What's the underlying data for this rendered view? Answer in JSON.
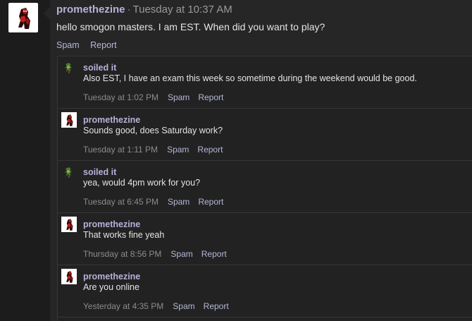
{
  "main_message": {
    "author": "promethezine",
    "separator": "·",
    "timestamp": "Tuesday at 10:37 AM",
    "body": "hello smogon masters. I am EST. When did you want to play?",
    "actions": {
      "spam": "Spam",
      "report": "Report"
    }
  },
  "comments": [
    {
      "author": "soiled it",
      "avatar": "plant-sprite-icon",
      "text": "Also EST, I have an exam this week so sometime during the weekend would be good.",
      "timestamp": "Tuesday at 1:02 PM",
      "spam": "Spam",
      "report": "Report"
    },
    {
      "author": "promethezine",
      "avatar": "deadpool-avatar",
      "text": "Sounds good, does Saturday work?",
      "timestamp": "Tuesday at 1:11 PM",
      "spam": "Spam",
      "report": "Report"
    },
    {
      "author": "soiled it",
      "avatar": "plant-sprite-icon",
      "text": "yea, would 4pm work for you?",
      "timestamp": "Tuesday at 6:45 PM",
      "spam": "Spam",
      "report": "Report"
    },
    {
      "author": "promethezine",
      "avatar": "deadpool-avatar",
      "text": "That works fine yeah",
      "timestamp": "Thursday at 8:56 PM",
      "spam": "Spam",
      "report": "Report"
    },
    {
      "author": "promethezine",
      "avatar": "deadpool-avatar",
      "text": "Are you online",
      "timestamp": "Yesterday at 4:35 PM",
      "spam": "Spam",
      "report": "Report"
    }
  ]
}
